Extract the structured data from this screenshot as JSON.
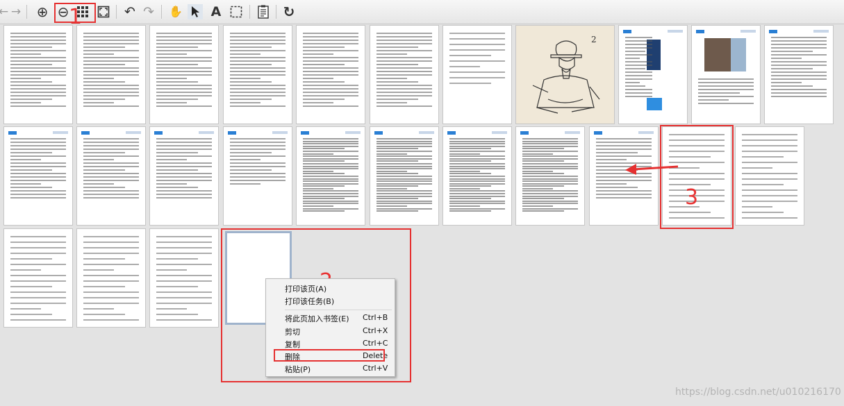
{
  "toolbar": {
    "buttons": [
      {
        "icon": "back-arrow-icon",
        "glyph": "←"
      },
      {
        "icon": "forward-arrow-icon",
        "glyph": "→"
      },
      {
        "icon": "zoom-in-icon",
        "glyph": "⊕"
      },
      {
        "icon": "zoom-out-icon",
        "glyph": "⊖"
      },
      {
        "icon": "thumbnail-grid-icon",
        "glyph": ""
      },
      {
        "icon": "fit-page-icon",
        "glyph": "⛶"
      },
      {
        "icon": "undo-icon",
        "glyph": "↶"
      },
      {
        "icon": "redo-icon",
        "glyph": "↷"
      },
      {
        "icon": "hand-tool-icon",
        "glyph": "✋"
      },
      {
        "icon": "select-arrow-icon",
        "glyph": "➤"
      },
      {
        "icon": "text-tool-icon",
        "glyph": "A"
      },
      {
        "icon": "marquee-select-icon",
        "glyph": ""
      },
      {
        "icon": "document-properties-icon",
        "glyph": "▤"
      },
      {
        "icon": "refresh-icon",
        "glyph": "↻"
      }
    ]
  },
  "annotations": {
    "step1": "1",
    "step2": "2",
    "step3": "3"
  },
  "context_menu": {
    "items": [
      {
        "label": "打印该页(A)",
        "shortcut": ""
      },
      {
        "label": "打印该任务(B)",
        "shortcut": ""
      },
      {
        "label": "将此页加入书签(E)",
        "shortcut": "Ctrl+B"
      },
      {
        "label": "剪切",
        "shortcut": "Ctrl+X"
      },
      {
        "label": "复制",
        "shortcut": "Ctrl+C"
      },
      {
        "label": "删除",
        "shortcut": "Delete"
      },
      {
        "label": "粘贴(P)",
        "shortcut": "Ctrl+V"
      }
    ]
  },
  "watermark": "https://blog.csdn.net/u010216170",
  "colors": {
    "annotation_red": "#e53030",
    "selected_thumb_border": "#9fb3cc"
  }
}
